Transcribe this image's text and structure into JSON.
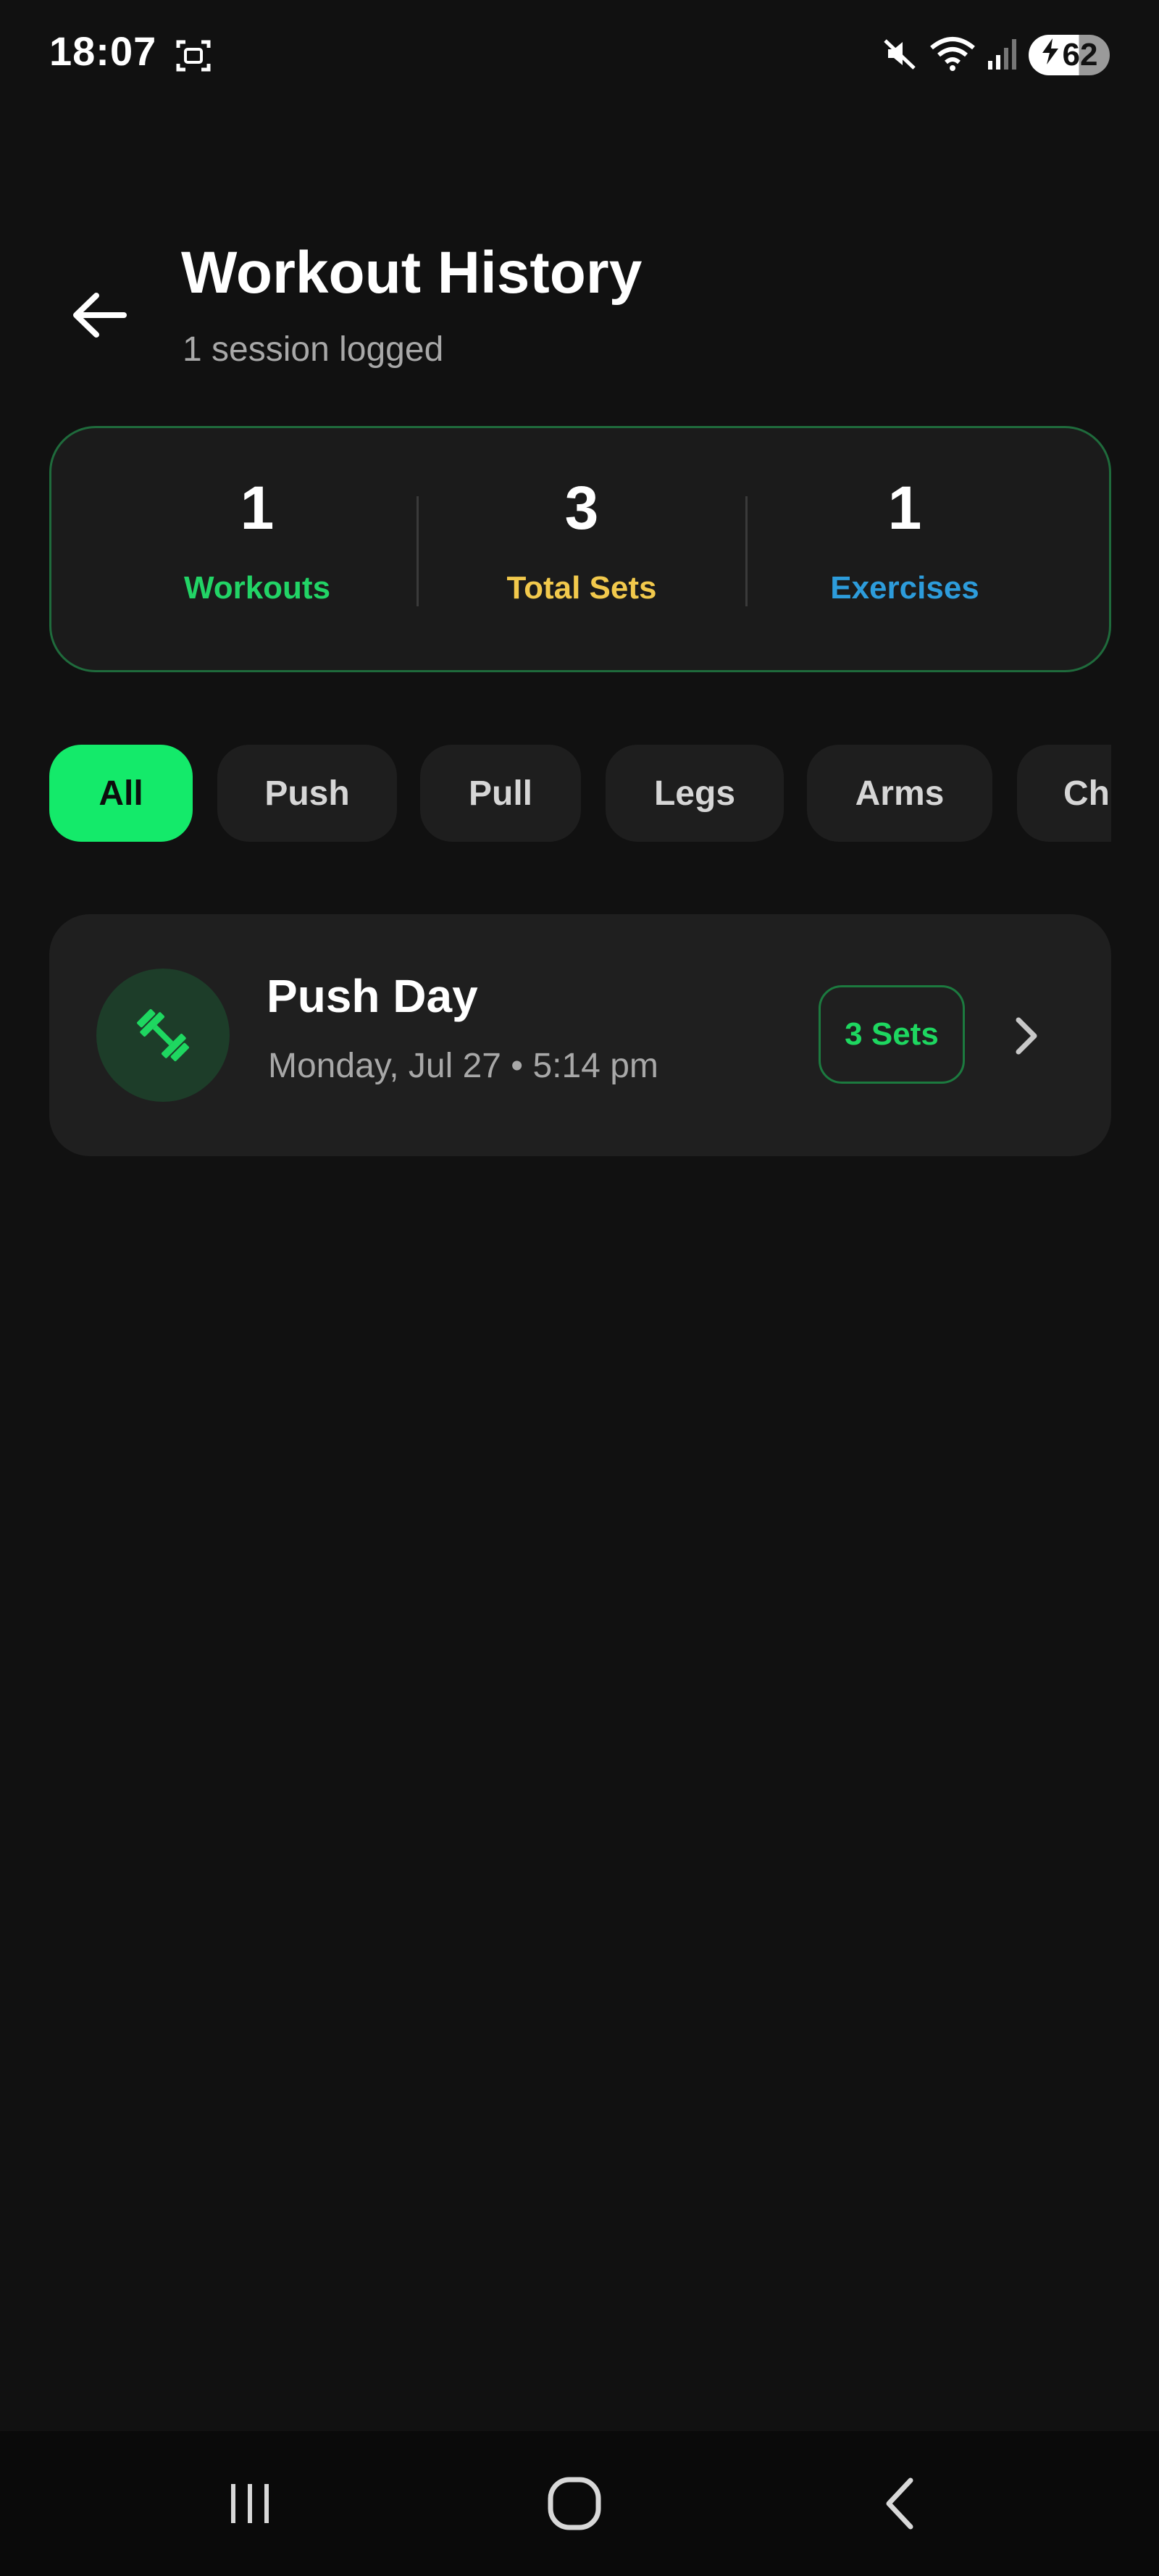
{
  "status_bar": {
    "time": "18:07",
    "battery_level": "62",
    "icons": [
      "screenshot-icon",
      "mute-icon",
      "wifi-icon",
      "signal-icon",
      "charging-icon"
    ]
  },
  "header": {
    "back_icon": "arrow-left-icon",
    "title": "Workout History",
    "subtitle": "1 session logged"
  },
  "stats": [
    {
      "value": "1",
      "label": "Workouts",
      "color": "#22d466"
    },
    {
      "value": "3",
      "label": "Total Sets",
      "color": "#f2c94c"
    },
    {
      "value": "1",
      "label": "Exercises",
      "color": "#2d9cdb"
    }
  ],
  "filters": {
    "selected": "All",
    "items": [
      "All",
      "Push",
      "Pull",
      "Legs",
      "Arms",
      "Ch"
    ]
  },
  "workouts": [
    {
      "name": "Push Day",
      "date": "Monday, Jul 27 • 5:14 pm",
      "sets_badge": "3 Sets",
      "icon": "dumbbell-icon"
    }
  ],
  "nav": {
    "icons": [
      "recent-apps-icon",
      "home-icon",
      "back-icon"
    ]
  },
  "colors": {
    "background": "#111111",
    "card": "#1f1f1f",
    "accent": "#14ea6a",
    "card_border": "#1f6b3c"
  }
}
